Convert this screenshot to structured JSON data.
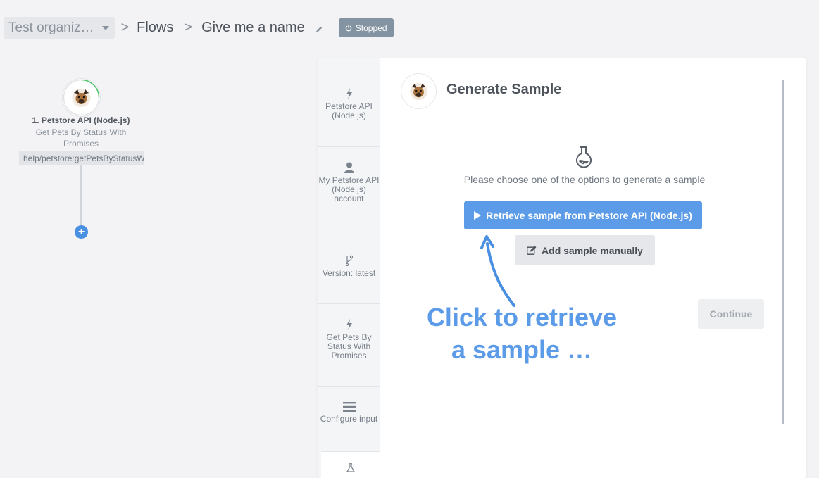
{
  "header": {
    "org_label": "Test organiz…",
    "separator": ">",
    "flows_label": "Flows",
    "flow_name": "Give me a name",
    "status_badge": "Stopped"
  },
  "flow_graph": {
    "node_title": "1. Petstore API (Node.js)",
    "node_subtitle": "Get Pets By Status With Promises",
    "node_path": "help/petstore:getPetsByStatusW"
  },
  "step_bar": {
    "steps": [
      {
        "icon": "bolt-icon",
        "label": "Petstore API (Node.js)"
      },
      {
        "icon": "user-icon",
        "label": "My Petstore API (Node.js) account"
      },
      {
        "icon": "branch-icon",
        "label": "Version: latest"
      },
      {
        "icon": "bolt-icon",
        "label": "Get Pets By Status With Promises"
      },
      {
        "icon": "menu-icon",
        "label": "Configure input"
      },
      {
        "icon": "flask-icon",
        "label": ""
      }
    ]
  },
  "content": {
    "title": "Generate Sample",
    "hint": "Please choose one of the options to generate a sample",
    "retrieve_button": "Retrieve sample from Petstore API (Node.js)",
    "manual_button": "Add sample manually",
    "continue_button": "Continue"
  },
  "overlay": {
    "callout": "Click to retrieve a sample …"
  },
  "colors": {
    "accent": "#5b9be8",
    "status_badge_bg": "#8393a2",
    "page_bg": "#f3f3f5"
  }
}
